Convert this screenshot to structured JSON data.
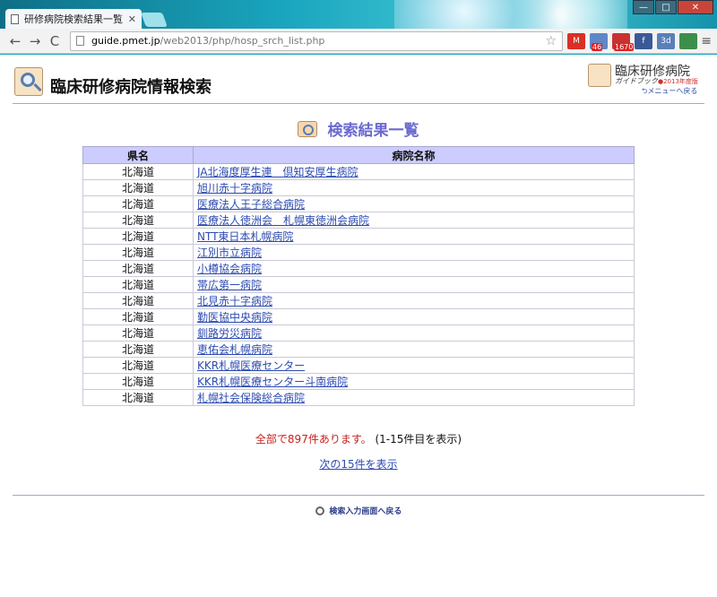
{
  "browser": {
    "tab_title": "研修病院検索結果一覧",
    "tab_close": "✕",
    "back": "←",
    "forward": "→",
    "reload": "C",
    "url_host": "guide.pmet.jp",
    "url_path": "/web2013/php/hosp_srch_list.php",
    "star": "☆",
    "extensions": [
      {
        "name": "gmail",
        "label": "M",
        "color": "#d93025",
        "badge": ""
      },
      {
        "name": "ext-46",
        "label": "",
        "color": "#5f87c7",
        "badge": "46"
      },
      {
        "name": "ext-1670",
        "label": "",
        "color": "#c83232",
        "badge": "1670"
      },
      {
        "name": "facebook",
        "label": "f",
        "color": "#3b5998",
        "badge": ""
      },
      {
        "name": "calendar",
        "label": "3d",
        "color": "#5b7fb8",
        "badge": ""
      },
      {
        "name": "ext-flag",
        "label": "",
        "color": "#3c8f4a",
        "badge": ""
      }
    ],
    "menu": "≡",
    "win_min": "—",
    "win_max": "□",
    "win_close": "✕"
  },
  "header": {
    "site_title": "臨床研修病院情報検索",
    "guide_title": "臨床研修病院",
    "guide_sub": "ガイドブック",
    "guide_year": "●2013年度版",
    "menu_back": "⮌メニューへ戻る"
  },
  "result": {
    "heading": "検索結果一覧",
    "columns": [
      "県名",
      "病院名称"
    ],
    "rows": [
      {
        "pref": "北海道",
        "name": "JA北海度厚生連　倶知安厚生病院"
      },
      {
        "pref": "北海道",
        "name": "旭川赤十字病院"
      },
      {
        "pref": "北海道",
        "name": "医療法人王子総合病院"
      },
      {
        "pref": "北海道",
        "name": "医療法人徳洲会　札幌東徳洲会病院"
      },
      {
        "pref": "北海道",
        "name": "NTT東日本札幌病院"
      },
      {
        "pref": "北海道",
        "name": "江別市立病院"
      },
      {
        "pref": "北海道",
        "name": "小樽協会病院"
      },
      {
        "pref": "北海道",
        "name": "帯広第一病院"
      },
      {
        "pref": "北海道",
        "name": "北見赤十字病院"
      },
      {
        "pref": "北海道",
        "name": "勤医協中央病院"
      },
      {
        "pref": "北海道",
        "name": "釧路労災病院"
      },
      {
        "pref": "北海道",
        "name": "恵佑会札幌病院"
      },
      {
        "pref": "北海道",
        "name": "KKR札幌医療センター"
      },
      {
        "pref": "北海道",
        "name": "KKR札幌医療センター斗南病院"
      },
      {
        "pref": "北海道",
        "name": "札幌社会保険総合病院"
      }
    ],
    "summary_red": "全部で897件あります。",
    "summary_black": "(1-15件目を表示)",
    "next": "次の15件を表示",
    "back_to_search": "検索入力画面へ戻る"
  }
}
